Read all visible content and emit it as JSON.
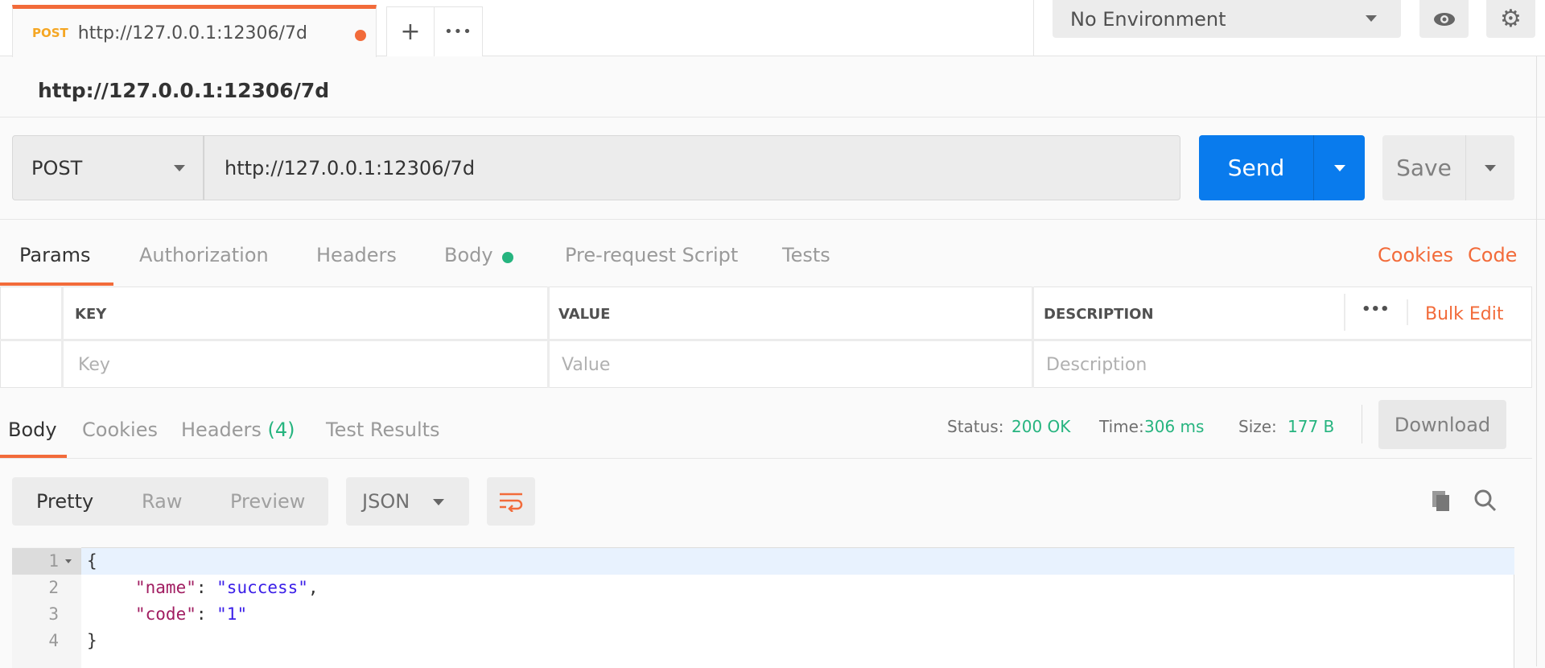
{
  "tab": {
    "method": "POST",
    "url": "http://127.0.0.1:12306/7d",
    "unsaved": true
  },
  "toolbar": {
    "new_tab": "+",
    "more": "•••",
    "environment": "No Environment",
    "eye_icon": "eye-icon",
    "gear_icon": "gear-icon"
  },
  "request": {
    "title": "http://127.0.0.1:12306/7d",
    "method": "POST",
    "url": "http://127.0.0.1:12306/7d",
    "send": "Send",
    "save": "Save"
  },
  "request_tabs": [
    {
      "label": "Params",
      "active": true
    },
    {
      "label": "Authorization"
    },
    {
      "label": "Headers"
    },
    {
      "label": "Body",
      "indicator": true
    },
    {
      "label": "Pre-request Script"
    },
    {
      "label": "Tests"
    }
  ],
  "request_links": {
    "cookies": "Cookies",
    "code": "Code"
  },
  "params_table": {
    "headers": [
      "KEY",
      "VALUE",
      "DESCRIPTION"
    ],
    "more": "•••",
    "bulk_edit": "Bulk Edit",
    "placeholders": [
      "Key",
      "Value",
      "Description"
    ]
  },
  "response_tabs": [
    {
      "label": "Body",
      "active": true
    },
    {
      "label": "Cookies"
    },
    {
      "label": "Headers",
      "count": "(4)"
    },
    {
      "label": "Test Results"
    }
  ],
  "response_meta": {
    "status_label": "Status:",
    "status": "200 OK",
    "time_label": "Time:",
    "time": "306 ms",
    "size_label": "Size:",
    "size": "177 B",
    "download": "Download"
  },
  "view": {
    "modes": [
      "Pretty",
      "Raw",
      "Preview"
    ],
    "active": "Pretty",
    "format": "JSON"
  },
  "body_lines": [
    {
      "n": "1",
      "fold": true,
      "text": "{"
    },
    {
      "n": "2",
      "key": "\"name\"",
      "value": "\"success\"",
      "trail": ","
    },
    {
      "n": "3",
      "key": "\"code\"",
      "value": "\"1\"",
      "trail": ""
    },
    {
      "n": "4",
      "text": "}"
    }
  ],
  "colors": {
    "accent": "#f26b3a",
    "primary": "#097bed",
    "success": "#26b47f",
    "method": "#f5a623"
  }
}
